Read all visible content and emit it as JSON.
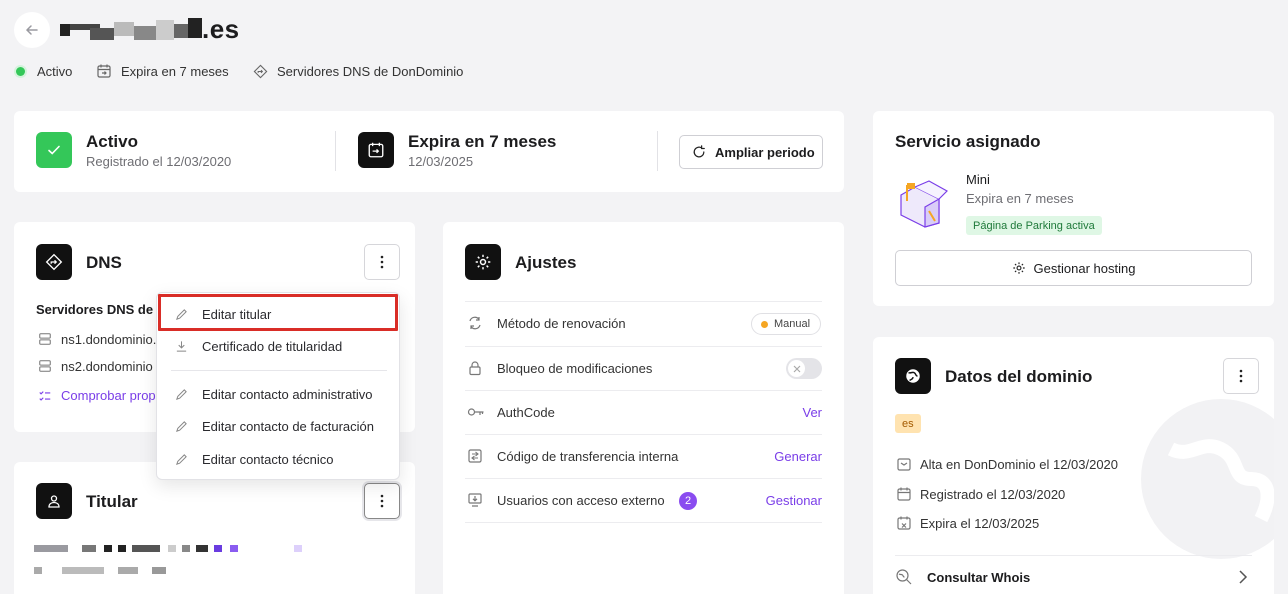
{
  "header": {
    "domain_suffix": ".es",
    "status": "Activo",
    "expires": "Expira en 7 meses",
    "dns_provider": "Servidores DNS de DonDominio"
  },
  "summary": {
    "status_title": "Activo",
    "status_sub": "Registrado el 12/03/2020",
    "expiry_title": "Expira en 7 meses",
    "expiry_sub": "12/03/2025",
    "extend_button": "Ampliar periodo"
  },
  "dns": {
    "title": "DNS",
    "servers_label": "Servidores DNS de D",
    "ns1": "ns1.dondominio.",
    "ns2": "ns2.dondominio",
    "check_link": "Comprobar prop"
  },
  "dropdown": {
    "items": [
      "Editar titular",
      "Certificado de titularidad",
      "Editar contacto administrativo",
      "Editar contacto de facturación",
      "Editar contacto técnico"
    ]
  },
  "titular": {
    "title": "Titular"
  },
  "ajustes": {
    "title": "Ajustes",
    "rows": [
      {
        "label": "Método de renovación",
        "value": "Manual"
      },
      {
        "label": "Bloqueo de modificaciones",
        "value": ""
      },
      {
        "label": "AuthCode",
        "value": "Ver"
      },
      {
        "label": "Código de transferencia interna",
        "value": "Generar"
      },
      {
        "label": "Usuarios con acceso externo",
        "badge": "2",
        "value": "Gestionar"
      }
    ]
  },
  "servicio": {
    "title": "Servicio asignado",
    "plan": "Mini",
    "plan_expiry": "Expira en 7 meses",
    "parking_badge": "Página de Parking activa",
    "manage_button": "Gestionar hosting"
  },
  "datos": {
    "title": "Datos del dominio",
    "tld_badge": "es",
    "alta": "Alta en DonDominio el 12/03/2020",
    "registrado": "Registrado el 12/03/2020",
    "expira": "Expira el 12/03/2025",
    "whois": "Consultar Whois"
  },
  "colors": {
    "accent": "#7a3ee8",
    "active_green": "#34c759",
    "highlight_red": "#d92d27"
  }
}
